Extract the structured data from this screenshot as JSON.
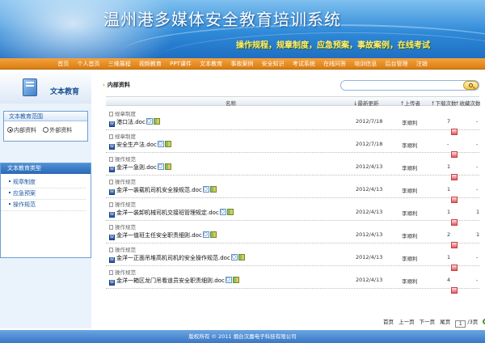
{
  "header": {
    "title": "温州港多媒体安全教育培训系统",
    "slogan": "操作规程，规章制度，应急预案，事故案例，在线考试"
  },
  "nav": [
    "首页",
    "个人首页",
    "三维展程",
    "视频教育",
    "PPT课件",
    "文本教育",
    "事故案例",
    "安全知识",
    "考试系统",
    "在线问答",
    "培训信息",
    "后台管理",
    "注销"
  ],
  "left": {
    "title": "文本教育",
    "scope_title": "文本教育范围",
    "scope_options": [
      "内部资料",
      "外部资料"
    ],
    "types_title": "文本教育类型",
    "types": [
      "规章制度",
      "应急预案",
      "操作规范"
    ]
  },
  "main": {
    "breadcrumb": "内部资料",
    "search_placeholder": "",
    "columns": {
      "name": "名称",
      "date": "↓最新更新",
      "uploader": "↑上传者",
      "downloads": "↑下载次数",
      "collects": "↑收藏次数"
    },
    "rows": [
      {
        "category": "规章制度",
        "name": "港口法.doc",
        "date": "2012/7/18",
        "uploader": "李顺利",
        "downloads": "7",
        "collects": "-"
      },
      {
        "category": "规章制度",
        "name": "安全生产法.doc",
        "date": "2012/7/18",
        "uploader": "李顺利",
        "downloads": "-",
        "collects": "-"
      },
      {
        "category": "操作规范",
        "name": "金洋一急则.doc",
        "date": "2012/4/13",
        "uploader": "李顺利",
        "downloads": "1",
        "collects": "-"
      },
      {
        "category": "操作规范",
        "name": "金洋一装载机司机安全操规范.doc",
        "date": "2012/4/13",
        "uploader": "李顺利",
        "downloads": "1",
        "collects": "-"
      },
      {
        "category": "操作规范",
        "name": "金洋一装卸机械司机交接班管理规定.doc",
        "date": "2012/4/13",
        "uploader": "李顺利",
        "downloads": "1",
        "collects": "1"
      },
      {
        "category": "操作规范",
        "name": "金洋一值班主任安全职责细则.doc",
        "date": "2012/4/13",
        "uploader": "李顺利",
        "downloads": "2",
        "collects": "1"
      },
      {
        "category": "操作规范",
        "name": "金洋一正面吊堆高机司机的安全操作规范.doc",
        "date": "2012/4/13",
        "uploader": "李顺利",
        "downloads": "1",
        "collects": "-"
      },
      {
        "category": "操作规范",
        "name": "金洋一箱区龙门吊看道员安全职责细则.doc",
        "date": "2012/4/13",
        "uploader": "李顺利",
        "downloads": "4",
        "collects": "-"
      }
    ],
    "pager": {
      "first": "首页",
      "prev": "上一页",
      "next": "下一页",
      "last": "尾页",
      "page": "1",
      "total": "/3页"
    }
  },
  "footer": "版权所有 © 2011 烟台汉嘉电子科技有限公司"
}
